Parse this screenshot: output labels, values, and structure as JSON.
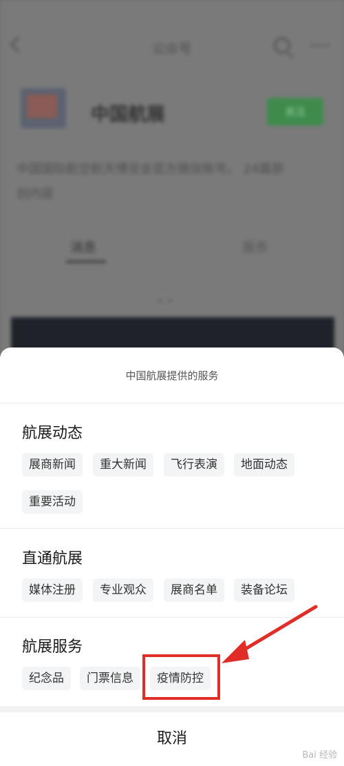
{
  "background": {
    "nav_title": "公众号",
    "account": {
      "name": "中国航展",
      "follow_label": "关注"
    },
    "description": "中国国际航空航天博览会官方微信账号。 24篇原创内容",
    "tabs": [
      "消息",
      "服务"
    ]
  },
  "sheet": {
    "title": "中国航展提供的服务",
    "sections": [
      {
        "title": "航展动态",
        "items": [
          "展商新闻",
          "重大新闻",
          "飞行表演",
          "地面动态",
          "重要活动"
        ]
      },
      {
        "title": "直通航展",
        "items": [
          "媒体注册",
          "专业观众",
          "展商名单",
          "装备论坛"
        ]
      },
      {
        "title": "航展服务",
        "items": [
          "纪念品",
          "门票信息",
          "疫情防控"
        ]
      }
    ],
    "cancel_label": "取消"
  },
  "colors": {
    "highlight": "#e02d28",
    "follow": "#07c160"
  }
}
